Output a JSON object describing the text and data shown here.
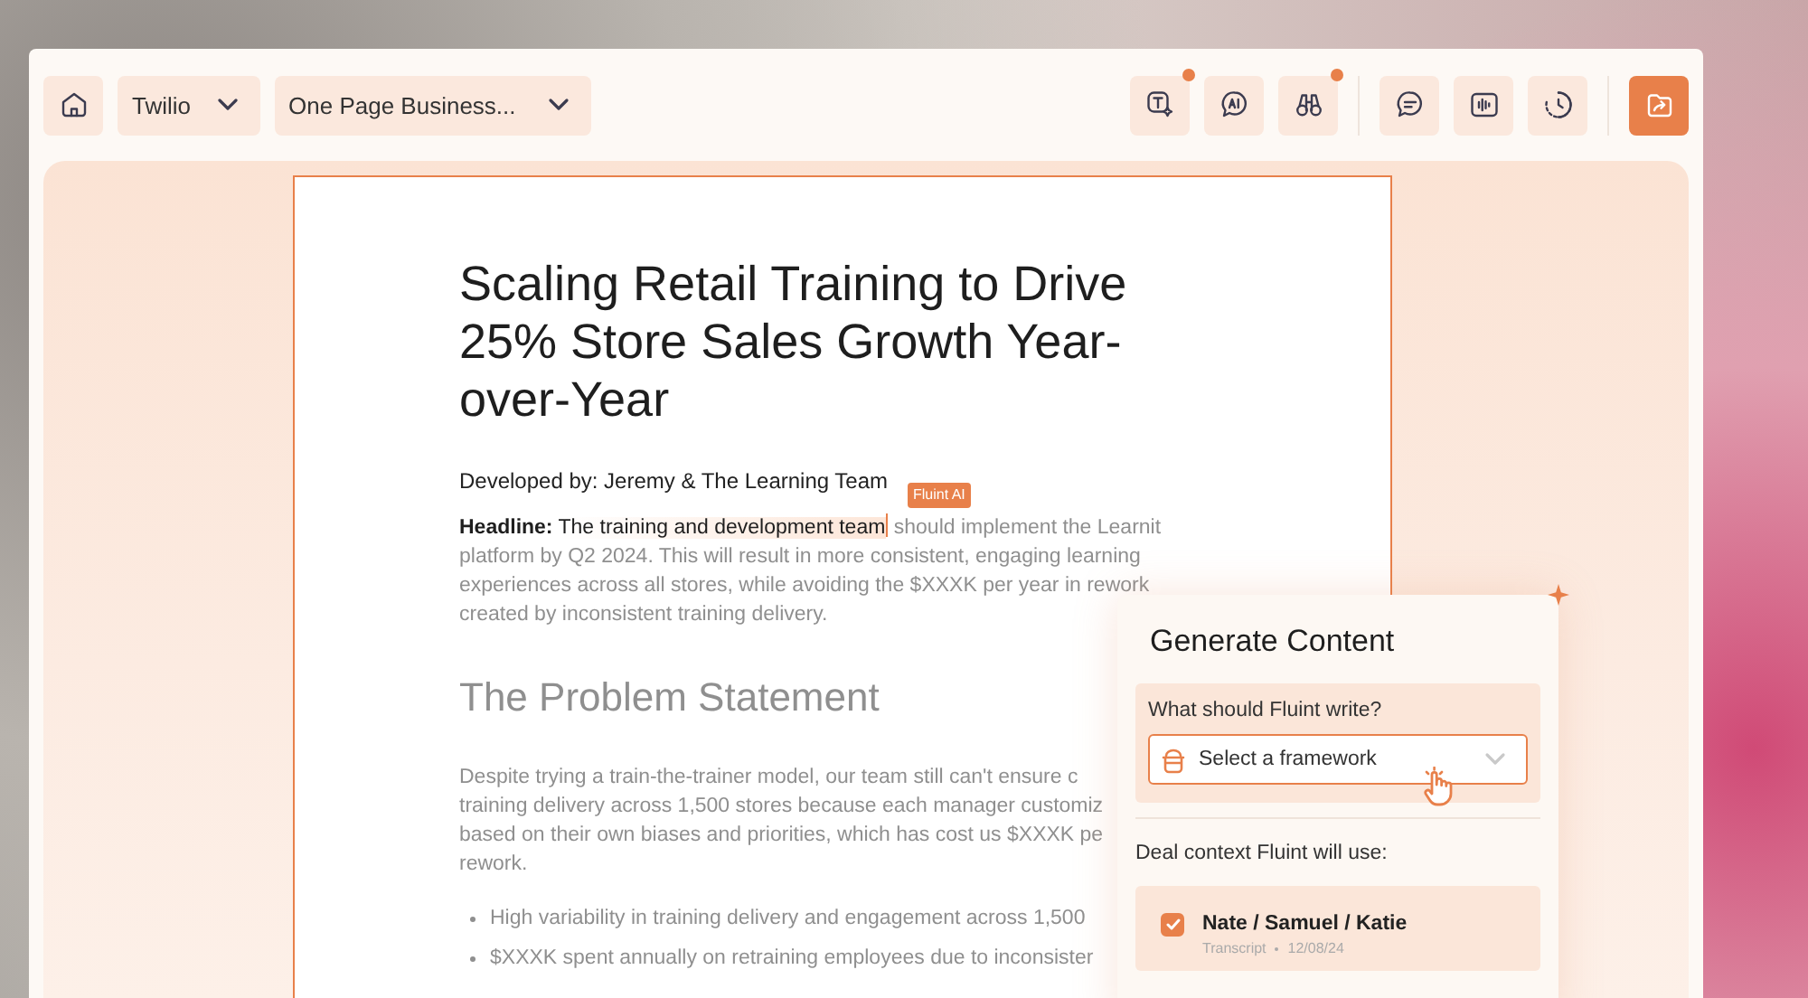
{
  "toolbar": {
    "dropdowns": [
      {
        "label": "Twilio"
      },
      {
        "label": "One Page Business..."
      }
    ],
    "groups": [
      [
        {
          "kind": "text-sparkle",
          "dot": true
        },
        {
          "kind": "ai-chat",
          "dot": false
        },
        {
          "kind": "binoculars",
          "dot": true
        }
      ],
      [
        {
          "kind": "chat",
          "dot": false
        },
        {
          "kind": "audio",
          "dot": false
        },
        {
          "kind": "history",
          "dot": false
        }
      ],
      [
        {
          "kind": "share",
          "dot": false
        }
      ]
    ]
  },
  "document": {
    "title": "Scaling Retail Training to Drive 25% Store Sales Growth Year-over-Year",
    "byline": "Developed by: Jeremy & The Learning Team",
    "headline": {
      "label": "Headline:",
      "highlighted": "The training and development team",
      "rest": "should implement the Learnit platform by Q2 2024. This will result in more consistent, engaging learning experiences across all stores, while avoiding the $XXXK per year in rework created by inconsistent training delivery.",
      "tag": "Fluint AI"
    },
    "section_heading": "The Problem Statement",
    "paragraph_lines": [
      "Despite trying a train-the-trainer model, our team still can't ensure c",
      "training delivery across 1,500 stores because each manager customiz",
      "based on their own biases and priorities, which has cost us $XXXK pe",
      "rework."
    ],
    "bullets": [
      "High variability in training delivery and engagement across 1,500",
      "$XXXK spent annually on retraining employees due to inconsister"
    ]
  },
  "popup": {
    "title": "Generate Content",
    "prompt_label": "What should Fluint write?",
    "select": {
      "placeholder": "Select a framework"
    },
    "context_label": "Deal context Fluint will use:",
    "context_items": [
      {
        "title": "Nate / Samuel / Katie",
        "type": "Transcript",
        "date": "12/08/24",
        "checked": true
      }
    ]
  }
}
